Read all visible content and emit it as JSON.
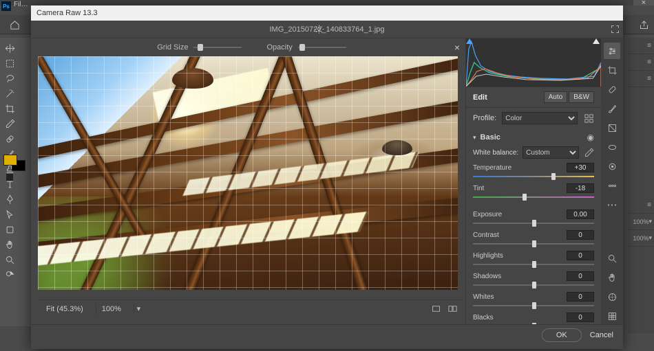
{
  "host": {
    "file_menu": "Fil…"
  },
  "titlebar": "Camera Raw 13.3",
  "filename": "IMG_20150722_140833764_1.jpg",
  "top_sliders": {
    "grid_size_label": "Grid Size",
    "opacity_label": "Opacity"
  },
  "zoom": {
    "fit": "Fit (45.3%)",
    "hundred": "100%"
  },
  "edit": {
    "heading": "Edit",
    "auto": "Auto",
    "bw": "B&W",
    "profile_label": "Profile:",
    "profile_value": "Color"
  },
  "basic": {
    "heading": "Basic",
    "wb_label": "White balance:",
    "wb_value": "Custom",
    "temperature_label": "Temperature",
    "temperature_value": "+30",
    "tint_label": "Tint",
    "tint_value": "-18",
    "exposure_label": "Exposure",
    "exposure_value": "0.00",
    "contrast_label": "Contrast",
    "contrast_value": "0",
    "highlights_label": "Highlights",
    "highlights_value": "0",
    "shadows_label": "Shadows",
    "shadows_value": "0",
    "whites_label": "Whites",
    "whites_value": "0",
    "blacks_label": "Blacks",
    "blacks_value": "0"
  },
  "footer": {
    "ok": "OK",
    "cancel": "Cancel"
  },
  "right_dock": {
    "pct": "100%"
  }
}
